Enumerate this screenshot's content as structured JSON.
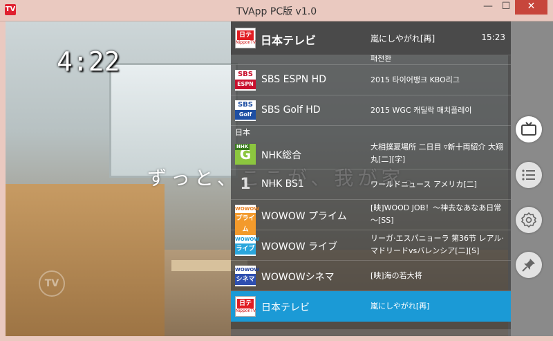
{
  "window": {
    "title": "TVApp PC版 v1.0",
    "icon_text": "TV",
    "min_glyph": "—",
    "max_glyph": "☐",
    "close_glyph": "✕"
  },
  "video": {
    "clock": "4:22",
    "caption": "ずっと、ここが、我が家。",
    "watermark": "TV"
  },
  "now_playing": {
    "channel": "日本テレビ",
    "program": "嵐にしやがれ[再]",
    "time": "15:23",
    "logo_icon": "ntv-logo-icon"
  },
  "list": {
    "partial_top_program": "패전환",
    "section_japan": "日本",
    "channels": [
      {
        "name": "SBS ESPN HD",
        "program": "2015 타이어뱅크 KBO리그",
        "logo": "sbs-espn-logo-icon",
        "logo_top": "SBS",
        "logo_bottom": "ESPN"
      },
      {
        "name": "SBS Golf HD",
        "program": "2015 WGC 캐딜락 매치플레이",
        "logo": "sbs-golf-logo-icon",
        "logo_top": "SBS",
        "logo_bottom": "Golf"
      },
      {
        "name": "NHK総合",
        "program": "大相撲夏場所 二日目 ▿新十両紹介 大翔丸[二][字]",
        "logo": "nhk-g-logo-icon",
        "logo_text": "G",
        "logo_small": "NHK"
      },
      {
        "name": "NHK BS1",
        "program": "ワールドニュース アメリカ[二]",
        "logo": "nhk-bs1-logo-icon",
        "logo_text": "1"
      },
      {
        "name": "WOWOW プライム",
        "program": "[映]WOOD JOB！～神去なあなあ日常～[SS]",
        "logo": "wowow-prime-logo-icon",
        "logo_top": "WOWOW",
        "logo_bottom": "プライム"
      },
      {
        "name": "WOWOW ライブ",
        "program": "リーガ·エスパニョーラ 第36节 レアル·マドリードvsバレンシア[二][S]",
        "logo": "wowow-live-logo-icon",
        "logo_top": "WOWOW",
        "logo_bottom": "ライブ"
      },
      {
        "name": "WOWOWシネマ",
        "program": "[映]海の若大将",
        "logo": "wowow-cinema-logo-icon",
        "logo_top": "WOWOW",
        "logo_bottom": "シネマ"
      },
      {
        "name": "日本テレビ",
        "program": "嵐にしやがれ[再]",
        "logo": "ntv-logo-icon",
        "selected": true
      }
    ]
  },
  "ntv_logo": {
    "main": "日テレ",
    "sub": "NipponTV"
  },
  "side_buttons": [
    {
      "name": "tv-icon",
      "active": true
    },
    {
      "name": "list-icon",
      "active": false
    },
    {
      "name": "settings-icon",
      "active": false
    },
    {
      "name": "pin-icon",
      "active": false
    }
  ],
  "colors": {
    "selected_row": "#1b9ad6",
    "panel_bg": "#3c3c3c",
    "titlebar": "#eac9c0",
    "close_button": "#c7463c"
  }
}
